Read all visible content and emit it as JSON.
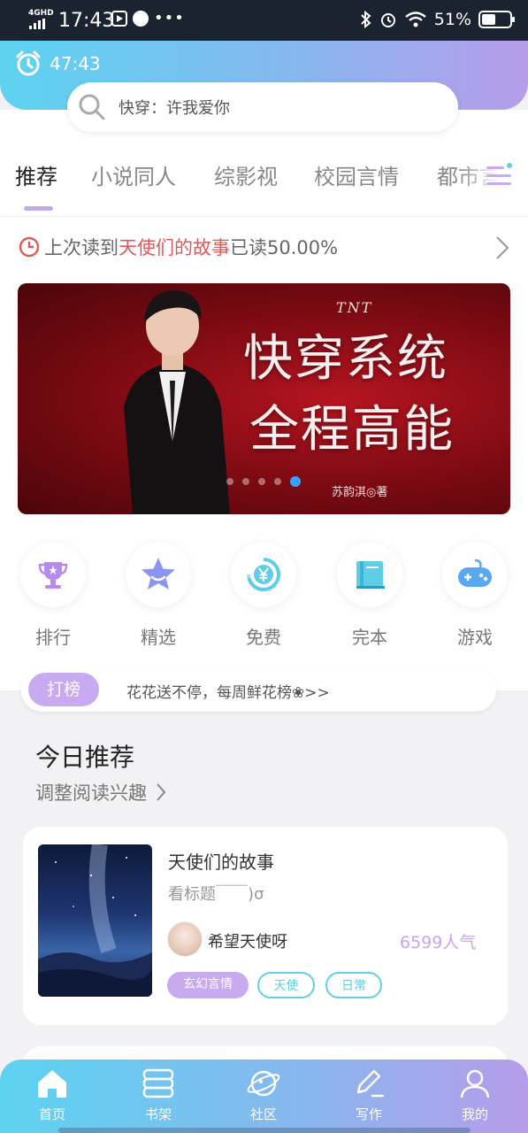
{
  "status_bar": {
    "network": "4GHD",
    "time": "17:43",
    "battery": "51%",
    "icons": [
      "signal-icon",
      "app-icon",
      "compass-icon",
      "more-dots",
      "bluetooth-icon",
      "alarm-icon",
      "wifi-icon",
      "battery-icon"
    ]
  },
  "header": {
    "timer": "47:43",
    "search_placeholder": "快穿：许我爱你"
  },
  "tabs": [
    {
      "label": "推荐",
      "active": true
    },
    {
      "label": "小说同人",
      "active": false
    },
    {
      "label": "综影视",
      "active": false
    },
    {
      "label": "校园言情",
      "active": false
    },
    {
      "label": "都市言情",
      "active": false
    }
  ],
  "last_read": {
    "prefix": "上次读到",
    "book": "天使们的故事",
    "suffix": "已读50.00%"
  },
  "banner": {
    "small": "TNT",
    "title_line1": "快穿系统",
    "title_line2": "全程高能",
    "author": "苏韵淇◎著",
    "dot_count": 5,
    "active_dot": 5
  },
  "quick_links": [
    {
      "label": "排行",
      "icon": "trophy-icon"
    },
    {
      "label": "精选",
      "icon": "star-icon"
    },
    {
      "label": "免费",
      "icon": "yen-coin-icon"
    },
    {
      "label": "完本",
      "icon": "book-icon"
    },
    {
      "label": "游戏",
      "icon": "gamepad-icon"
    }
  ],
  "rank_strip": {
    "badge": "打榜",
    "text": "花花送不停，每周鲜花榜❀>>"
  },
  "today": {
    "title": "今日推荐",
    "subtitle": "调整阅读兴趣"
  },
  "recommend_card": {
    "title": "天使们的故事",
    "desc": "看标题￣￣)σ",
    "author": "希望天使呀",
    "popularity": "6599人气",
    "tags": [
      "玄幻言情",
      "天使",
      "日常"
    ]
  },
  "bottom_nav": [
    {
      "label": "首页",
      "icon": "home-icon"
    },
    {
      "label": "书架",
      "icon": "bookshelf-icon"
    },
    {
      "label": "社区",
      "icon": "community-icon"
    },
    {
      "label": "写作",
      "icon": "write-icon"
    },
    {
      "label": "我的",
      "icon": "profile-icon"
    }
  ],
  "colors": {
    "accent_purple": "#c8aaf0",
    "accent_cyan": "#5fd0e6",
    "gradient_start": "#5dd3f0",
    "gradient_end": "#b79cea",
    "highlight_red": "#e25757"
  }
}
